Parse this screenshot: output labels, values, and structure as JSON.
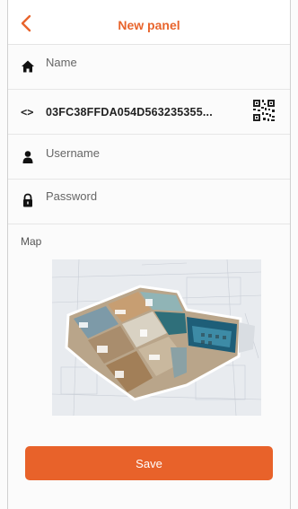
{
  "header": {
    "title": "New panel",
    "back_icon": "chevron-left-icon"
  },
  "form": {
    "name": {
      "placeholder": "Name",
      "icon": "home-icon"
    },
    "panel_id": {
      "value": "03FC38FFDA054D563235355...",
      "icon": "code-brackets-icon",
      "qr_icon": "qr-code-icon"
    },
    "username": {
      "placeholder": "Username",
      "icon": "user-icon"
    },
    "password": {
      "placeholder": "Password",
      "icon": "lock-icon"
    }
  },
  "map": {
    "label": "Map",
    "image": "3d-floor-plan"
  },
  "save_button": {
    "label": "Save"
  },
  "colors": {
    "accent": "#e8642c",
    "button": "#e8622a",
    "background": "#fbfbfb"
  }
}
